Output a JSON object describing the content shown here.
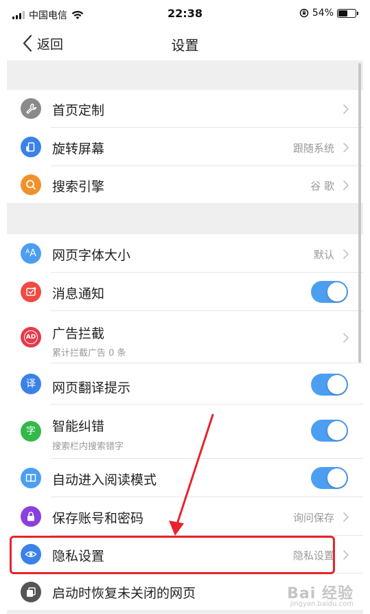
{
  "status_bar": {
    "carrier": "中国电信",
    "time": "22:38",
    "battery": "54%",
    "battery_level": 0.54
  },
  "nav": {
    "back_label": "返回",
    "title": "设置"
  },
  "rows": {
    "homepage": {
      "label": "首页定制",
      "icon": "wrench-icon",
      "color": "#8a8a8a"
    },
    "rotate": {
      "label": "旋转屏幕",
      "value": "跟随系统",
      "icon": "rotate-screen-icon",
      "color": "#3b82e8"
    },
    "search": {
      "label": "搜索引擎",
      "value": "谷 歌",
      "icon": "search-icon",
      "color": "#f0912b"
    },
    "font": {
      "label": "网页字体大小",
      "value": "默认",
      "icon": "font-size-icon",
      "glyph": "ᴬA",
      "color": "#4c9ff0"
    },
    "notify": {
      "label": "消息通知",
      "icon": "notification-icon",
      "color": "#ef4a43",
      "toggle": true
    },
    "adblock": {
      "label": "广告拦截",
      "sub": "累计拦截广告 0 条",
      "icon": "ad-block-icon",
      "glyph": "AD",
      "color": "#e63a4a"
    },
    "translate": {
      "label": "网页翻译提示",
      "icon": "translate-icon",
      "glyph": "译",
      "color": "#3b82e8",
      "toggle": true
    },
    "spellcheck": {
      "label": "智能纠错",
      "sub": "搜索栏内搜索错字",
      "icon": "spellcheck-icon",
      "glyph": "字",
      "color": "#34b84a",
      "toggle": true
    },
    "reader": {
      "label": "自动进入阅读模式",
      "icon": "book-icon",
      "color": "#4c9ff0",
      "toggle": true
    },
    "password": {
      "label": "保存账号和密码",
      "value": "询问保存",
      "icon": "lock-icon",
      "color": "#8a3fe0"
    },
    "privacy": {
      "label": "隐私设置",
      "value": "隐私设置",
      "icon": "eye-icon",
      "color": "#3b82e8"
    },
    "restore": {
      "label": "启动时恢复未关闭的网页",
      "icon": "pages-icon",
      "color": "#555555"
    }
  },
  "watermark": {
    "text": "Bai 经验",
    "url": "jingyan.baidu.com"
  },
  "colors": {
    "toggle_on": "#4c9ff0",
    "highlight": "#e8232b",
    "section_gap": "#efefef"
  }
}
